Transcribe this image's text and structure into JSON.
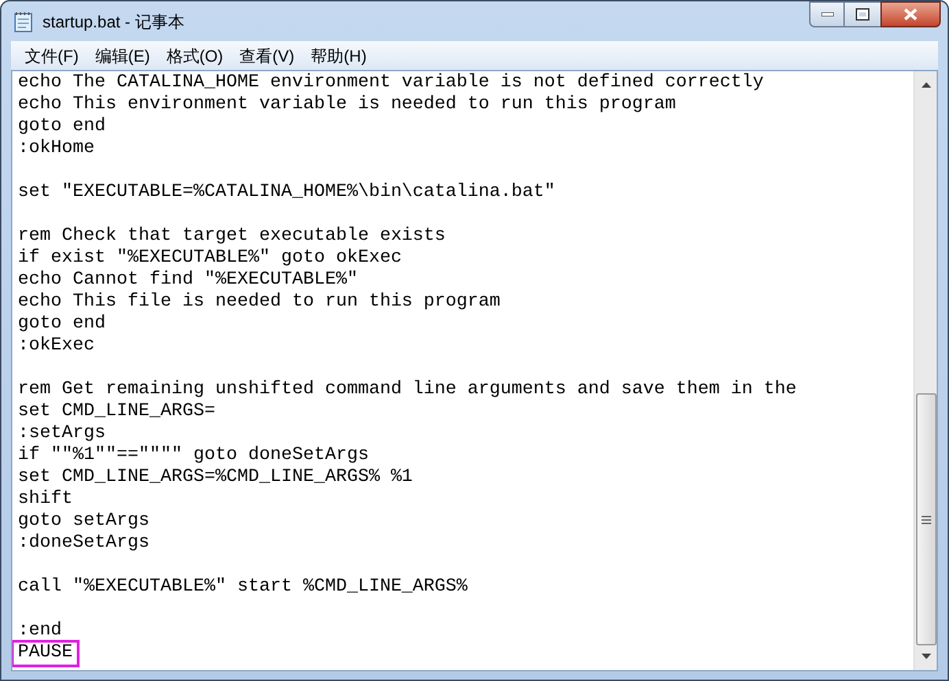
{
  "window": {
    "title": "startup.bat - 记事本"
  },
  "menu": [
    {
      "label": "文件(F)"
    },
    {
      "label": "编辑(E)"
    },
    {
      "label": "格式(O)"
    },
    {
      "label": "查看(V)"
    },
    {
      "label": "帮助(H)"
    }
  ],
  "editor": {
    "lines": [
      {
        "kind": "code",
        "text": "echo The CATALINA_HOME environment variable is not defined correctly",
        "highlighted": false
      },
      {
        "kind": "code",
        "text": "echo This environment variable is needed to run this program",
        "highlighted": false
      },
      {
        "kind": "code",
        "text": "goto end",
        "highlighted": false
      },
      {
        "kind": "code",
        "text": ":okHome",
        "highlighted": false
      },
      {
        "kind": "blank"
      },
      {
        "kind": "code",
        "text": "set \"EXECUTABLE=%CATALINA_HOME%\\bin\\catalina.bat\"",
        "highlighted": false
      },
      {
        "kind": "blank"
      },
      {
        "kind": "code",
        "text": "rem Check that target executable exists",
        "highlighted": false
      },
      {
        "kind": "code",
        "text": "if exist \"%EXECUTABLE%\" goto okExec",
        "highlighted": false
      },
      {
        "kind": "code",
        "text": "echo Cannot find \"%EXECUTABLE%\"",
        "highlighted": false
      },
      {
        "kind": "code",
        "text": "echo This file is needed to run this program",
        "highlighted": false
      },
      {
        "kind": "code",
        "text": "goto end",
        "highlighted": false
      },
      {
        "kind": "code",
        "text": ":okExec",
        "highlighted": false
      },
      {
        "kind": "blank"
      },
      {
        "kind": "code",
        "text": "rem Get remaining unshifted command line arguments and save them in the",
        "highlighted": false
      },
      {
        "kind": "code",
        "text": "set CMD_LINE_ARGS=",
        "highlighted": false
      },
      {
        "kind": "code",
        "text": ":setArgs",
        "highlighted": false
      },
      {
        "kind": "code",
        "text": "if \"\"%1\"\"==\"\"\"\" goto doneSetArgs",
        "highlighted": false
      },
      {
        "kind": "code",
        "text": "set CMD_LINE_ARGS=%CMD_LINE_ARGS% %1",
        "highlighted": false
      },
      {
        "kind": "code",
        "text": "shift",
        "highlighted": false
      },
      {
        "kind": "code",
        "text": "goto setArgs",
        "highlighted": false
      },
      {
        "kind": "code",
        "text": ":doneSetArgs",
        "highlighted": false
      },
      {
        "kind": "blank"
      },
      {
        "kind": "code",
        "text": "call \"%EXECUTABLE%\" start %CMD_LINE_ARGS%",
        "highlighted": false
      },
      {
        "kind": "blank"
      },
      {
        "kind": "code",
        "text": ":end",
        "highlighted": false
      },
      {
        "kind": "code",
        "text": "PAUSE",
        "highlighted": true
      }
    ]
  }
}
